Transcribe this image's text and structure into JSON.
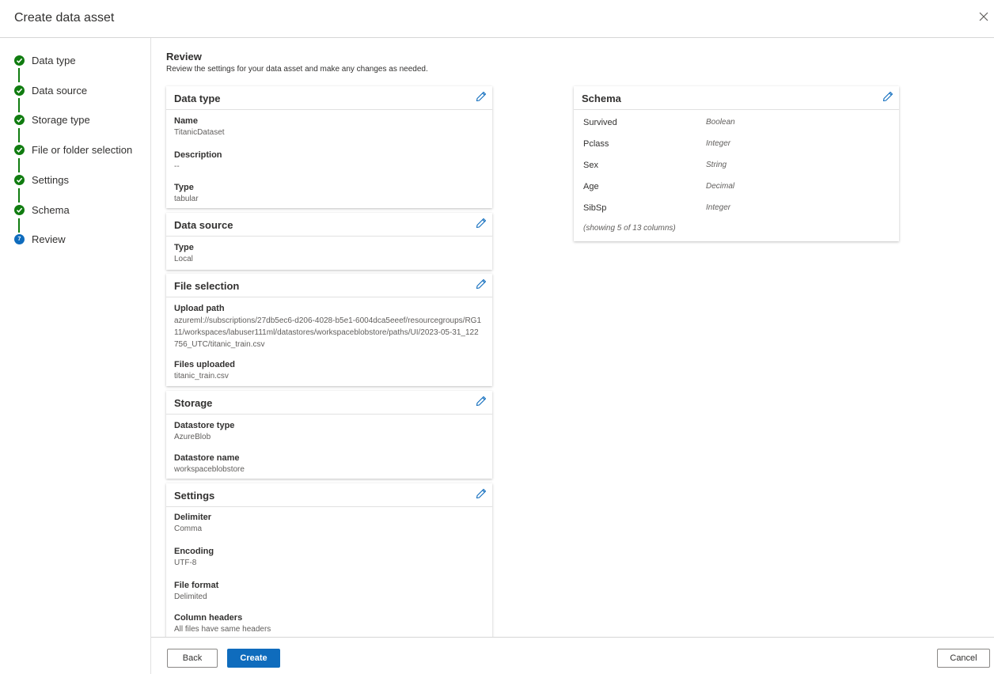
{
  "header": {
    "title": "Create data asset"
  },
  "steps": [
    {
      "label": "Data type"
    },
    {
      "label": "Data source"
    },
    {
      "label": "Storage type"
    },
    {
      "label": "File or folder selection"
    },
    {
      "label": "Settings"
    },
    {
      "label": "Schema"
    },
    {
      "label": "Review",
      "number": "7"
    }
  ],
  "review": {
    "title": "Review",
    "subtitle": "Review the settings for your data asset and make any changes as needed."
  },
  "cards": {
    "data_type": {
      "title": "Data type",
      "name_label": "Name",
      "name_value": "TitanicDataset",
      "desc_label": "Description",
      "desc_value": "--",
      "type_label": "Type",
      "type_value": "tabular"
    },
    "data_source": {
      "title": "Data source",
      "type_label": "Type",
      "type_value": "Local"
    },
    "file_selection": {
      "title": "File selection",
      "path_label": "Upload path",
      "path_value": "azureml://subscriptions/27db5ec6-d206-4028-b5e1-6004dca5eeef/resourcegroups/RG111/workspaces/labuser111ml/datastores/workspaceblobstore/paths/UI/2023-05-31_122756_UTC/titanic_train.csv",
      "files_label": "Files uploaded",
      "files_value": "titanic_train.csv"
    },
    "storage": {
      "title": "Storage",
      "dstype_label": "Datastore type",
      "dstype_value": "AzureBlob",
      "dsname_label": "Datastore name",
      "dsname_value": "workspaceblobstore"
    },
    "settings": {
      "title": "Settings",
      "delim_label": "Delimiter",
      "delim_value": "Comma",
      "enc_label": "Encoding",
      "enc_value": "UTF-8",
      "format_label": "File format",
      "format_value": "Delimited",
      "headers_label": "Column headers",
      "headers_value": "All files have same headers"
    },
    "schema": {
      "title": "Schema",
      "rows": [
        {
          "column": "Survived",
          "type": "Boolean"
        },
        {
          "column": "Pclass",
          "type": "Integer"
        },
        {
          "column": "Sex",
          "type": "String"
        },
        {
          "column": "Age",
          "type": "Decimal"
        },
        {
          "column": "SibSp",
          "type": "Integer"
        }
      ],
      "note": "(showing 5 of 13 columns)"
    }
  },
  "footer": {
    "back_label": "Back",
    "create_label": "Create",
    "cancel_label": "Cancel"
  },
  "colors": {
    "accent": "#0f6cbd",
    "success": "#107c10"
  }
}
